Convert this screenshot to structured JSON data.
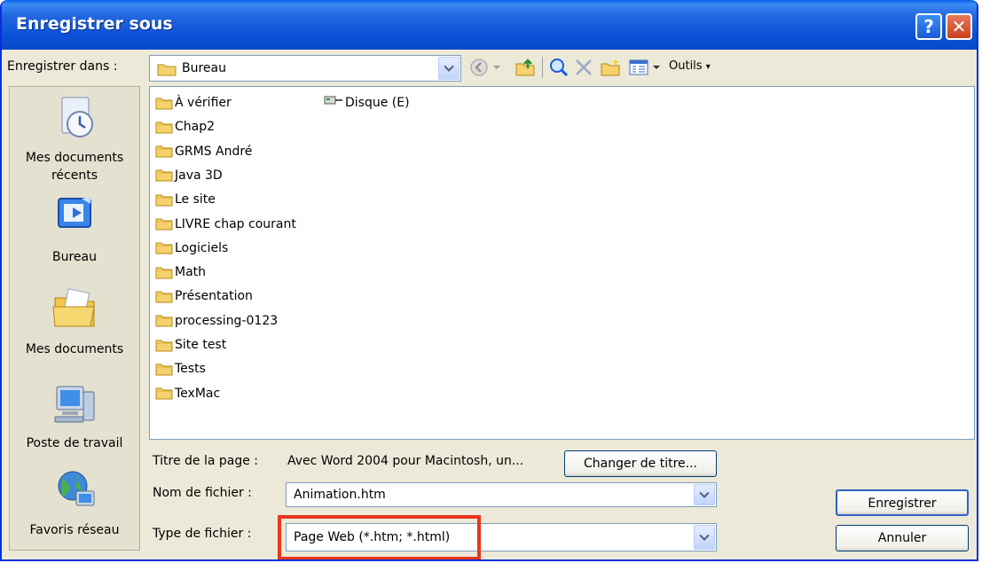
{
  "window": {
    "title": "Enregistrer sous"
  },
  "titlebar_buttons": {
    "help": "?",
    "close": "✕"
  },
  "lookin": {
    "label": "Enregistrer dans :",
    "value": "Bureau"
  },
  "toolbar": {
    "tools_label": "Outils"
  },
  "places": [
    {
      "label1": "Mes documents",
      "label2": "récents",
      "icon": "recent-documents-icon"
    },
    {
      "label1": "Bureau",
      "label2": "",
      "icon": "desktop-icon"
    },
    {
      "label1": "Mes documents",
      "label2": "",
      "icon": "my-documents-icon"
    },
    {
      "label1": "Poste de travail",
      "label2": "",
      "icon": "my-computer-icon"
    },
    {
      "label1": "Favoris réseau",
      "label2": "",
      "icon": "network-places-icon"
    }
  ],
  "files": {
    "column1": [
      "À vérifier",
      "Chap2",
      "GRMS André",
      "Java 3D",
      "Le site",
      "LIVRE chap courant",
      "Logiciels",
      "Math",
      "Présentation",
      "processing-0123",
      "Site test",
      "Tests",
      "TexMac"
    ],
    "column2": [
      "Disque (E)"
    ]
  },
  "page_title": {
    "label": "Titre de la page :",
    "value": "Avec Word 2004 pour Macintosh, un...",
    "change_button": "Changer de titre..."
  },
  "filename": {
    "label": "Nom de fichier :",
    "value": "Animation.htm"
  },
  "filetype": {
    "label": "Type de fichier :",
    "value": "Page Web (*.htm; *.html)"
  },
  "buttons": {
    "save": "Enregistrer",
    "cancel": "Annuler"
  },
  "colors": {
    "titlebar": "#0b52d8",
    "highlight_box": "#e8361b"
  }
}
